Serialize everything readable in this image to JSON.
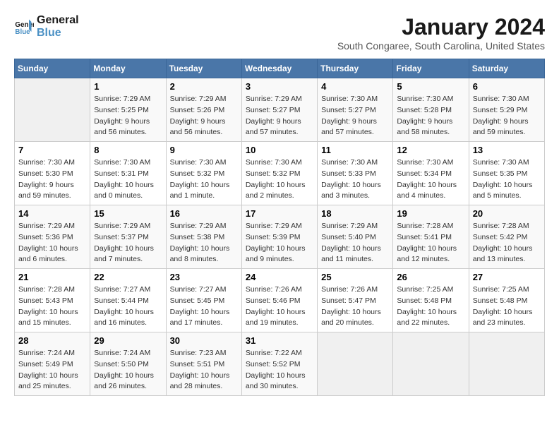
{
  "header": {
    "logo_line1": "General",
    "logo_line2": "Blue",
    "title": "January 2024",
    "subtitle": "South Congaree, South Carolina, United States"
  },
  "weekdays": [
    "Sunday",
    "Monday",
    "Tuesday",
    "Wednesday",
    "Thursday",
    "Friday",
    "Saturday"
  ],
  "weeks": [
    [
      {
        "day": "",
        "sunrise": "",
        "sunset": "",
        "daylight": "",
        "empty": true
      },
      {
        "day": "1",
        "sunrise": "Sunrise: 7:29 AM",
        "sunset": "Sunset: 5:25 PM",
        "daylight": "Daylight: 9 hours and 56 minutes."
      },
      {
        "day": "2",
        "sunrise": "Sunrise: 7:29 AM",
        "sunset": "Sunset: 5:26 PM",
        "daylight": "Daylight: 9 hours and 56 minutes."
      },
      {
        "day": "3",
        "sunrise": "Sunrise: 7:29 AM",
        "sunset": "Sunset: 5:27 PM",
        "daylight": "Daylight: 9 hours and 57 minutes."
      },
      {
        "day": "4",
        "sunrise": "Sunrise: 7:30 AM",
        "sunset": "Sunset: 5:27 PM",
        "daylight": "Daylight: 9 hours and 57 minutes."
      },
      {
        "day": "5",
        "sunrise": "Sunrise: 7:30 AM",
        "sunset": "Sunset: 5:28 PM",
        "daylight": "Daylight: 9 hours and 58 minutes."
      },
      {
        "day": "6",
        "sunrise": "Sunrise: 7:30 AM",
        "sunset": "Sunset: 5:29 PM",
        "daylight": "Daylight: 9 hours and 59 minutes."
      }
    ],
    [
      {
        "day": "7",
        "sunrise": "Sunrise: 7:30 AM",
        "sunset": "Sunset: 5:30 PM",
        "daylight": "Daylight: 9 hours and 59 minutes."
      },
      {
        "day": "8",
        "sunrise": "Sunrise: 7:30 AM",
        "sunset": "Sunset: 5:31 PM",
        "daylight": "Daylight: 10 hours and 0 minutes."
      },
      {
        "day": "9",
        "sunrise": "Sunrise: 7:30 AM",
        "sunset": "Sunset: 5:32 PM",
        "daylight": "Daylight: 10 hours and 1 minute."
      },
      {
        "day": "10",
        "sunrise": "Sunrise: 7:30 AM",
        "sunset": "Sunset: 5:32 PM",
        "daylight": "Daylight: 10 hours and 2 minutes."
      },
      {
        "day": "11",
        "sunrise": "Sunrise: 7:30 AM",
        "sunset": "Sunset: 5:33 PM",
        "daylight": "Daylight: 10 hours and 3 minutes."
      },
      {
        "day": "12",
        "sunrise": "Sunrise: 7:30 AM",
        "sunset": "Sunset: 5:34 PM",
        "daylight": "Daylight: 10 hours and 4 minutes."
      },
      {
        "day": "13",
        "sunrise": "Sunrise: 7:30 AM",
        "sunset": "Sunset: 5:35 PM",
        "daylight": "Daylight: 10 hours and 5 minutes."
      }
    ],
    [
      {
        "day": "14",
        "sunrise": "Sunrise: 7:29 AM",
        "sunset": "Sunset: 5:36 PM",
        "daylight": "Daylight: 10 hours and 6 minutes."
      },
      {
        "day": "15",
        "sunrise": "Sunrise: 7:29 AM",
        "sunset": "Sunset: 5:37 PM",
        "daylight": "Daylight: 10 hours and 7 minutes."
      },
      {
        "day": "16",
        "sunrise": "Sunrise: 7:29 AM",
        "sunset": "Sunset: 5:38 PM",
        "daylight": "Daylight: 10 hours and 8 minutes."
      },
      {
        "day": "17",
        "sunrise": "Sunrise: 7:29 AM",
        "sunset": "Sunset: 5:39 PM",
        "daylight": "Daylight: 10 hours and 9 minutes."
      },
      {
        "day": "18",
        "sunrise": "Sunrise: 7:29 AM",
        "sunset": "Sunset: 5:40 PM",
        "daylight": "Daylight: 10 hours and 11 minutes."
      },
      {
        "day": "19",
        "sunrise": "Sunrise: 7:28 AM",
        "sunset": "Sunset: 5:41 PM",
        "daylight": "Daylight: 10 hours and 12 minutes."
      },
      {
        "day": "20",
        "sunrise": "Sunrise: 7:28 AM",
        "sunset": "Sunset: 5:42 PM",
        "daylight": "Daylight: 10 hours and 13 minutes."
      }
    ],
    [
      {
        "day": "21",
        "sunrise": "Sunrise: 7:28 AM",
        "sunset": "Sunset: 5:43 PM",
        "daylight": "Daylight: 10 hours and 15 minutes."
      },
      {
        "day": "22",
        "sunrise": "Sunrise: 7:27 AM",
        "sunset": "Sunset: 5:44 PM",
        "daylight": "Daylight: 10 hours and 16 minutes."
      },
      {
        "day": "23",
        "sunrise": "Sunrise: 7:27 AM",
        "sunset": "Sunset: 5:45 PM",
        "daylight": "Daylight: 10 hours and 17 minutes."
      },
      {
        "day": "24",
        "sunrise": "Sunrise: 7:26 AM",
        "sunset": "Sunset: 5:46 PM",
        "daylight": "Daylight: 10 hours and 19 minutes."
      },
      {
        "day": "25",
        "sunrise": "Sunrise: 7:26 AM",
        "sunset": "Sunset: 5:47 PM",
        "daylight": "Daylight: 10 hours and 20 minutes."
      },
      {
        "day": "26",
        "sunrise": "Sunrise: 7:25 AM",
        "sunset": "Sunset: 5:48 PM",
        "daylight": "Daylight: 10 hours and 22 minutes."
      },
      {
        "day": "27",
        "sunrise": "Sunrise: 7:25 AM",
        "sunset": "Sunset: 5:48 PM",
        "daylight": "Daylight: 10 hours and 23 minutes."
      }
    ],
    [
      {
        "day": "28",
        "sunrise": "Sunrise: 7:24 AM",
        "sunset": "Sunset: 5:49 PM",
        "daylight": "Daylight: 10 hours and 25 minutes."
      },
      {
        "day": "29",
        "sunrise": "Sunrise: 7:24 AM",
        "sunset": "Sunset: 5:50 PM",
        "daylight": "Daylight: 10 hours and 26 minutes."
      },
      {
        "day": "30",
        "sunrise": "Sunrise: 7:23 AM",
        "sunset": "Sunset: 5:51 PM",
        "daylight": "Daylight: 10 hours and 28 minutes."
      },
      {
        "day": "31",
        "sunrise": "Sunrise: 7:22 AM",
        "sunset": "Sunset: 5:52 PM",
        "daylight": "Daylight: 10 hours and 30 minutes."
      },
      {
        "day": "",
        "sunrise": "",
        "sunset": "",
        "daylight": "",
        "empty": true
      },
      {
        "day": "",
        "sunrise": "",
        "sunset": "",
        "daylight": "",
        "empty": true
      },
      {
        "day": "",
        "sunrise": "",
        "sunset": "",
        "daylight": "",
        "empty": true
      }
    ]
  ]
}
